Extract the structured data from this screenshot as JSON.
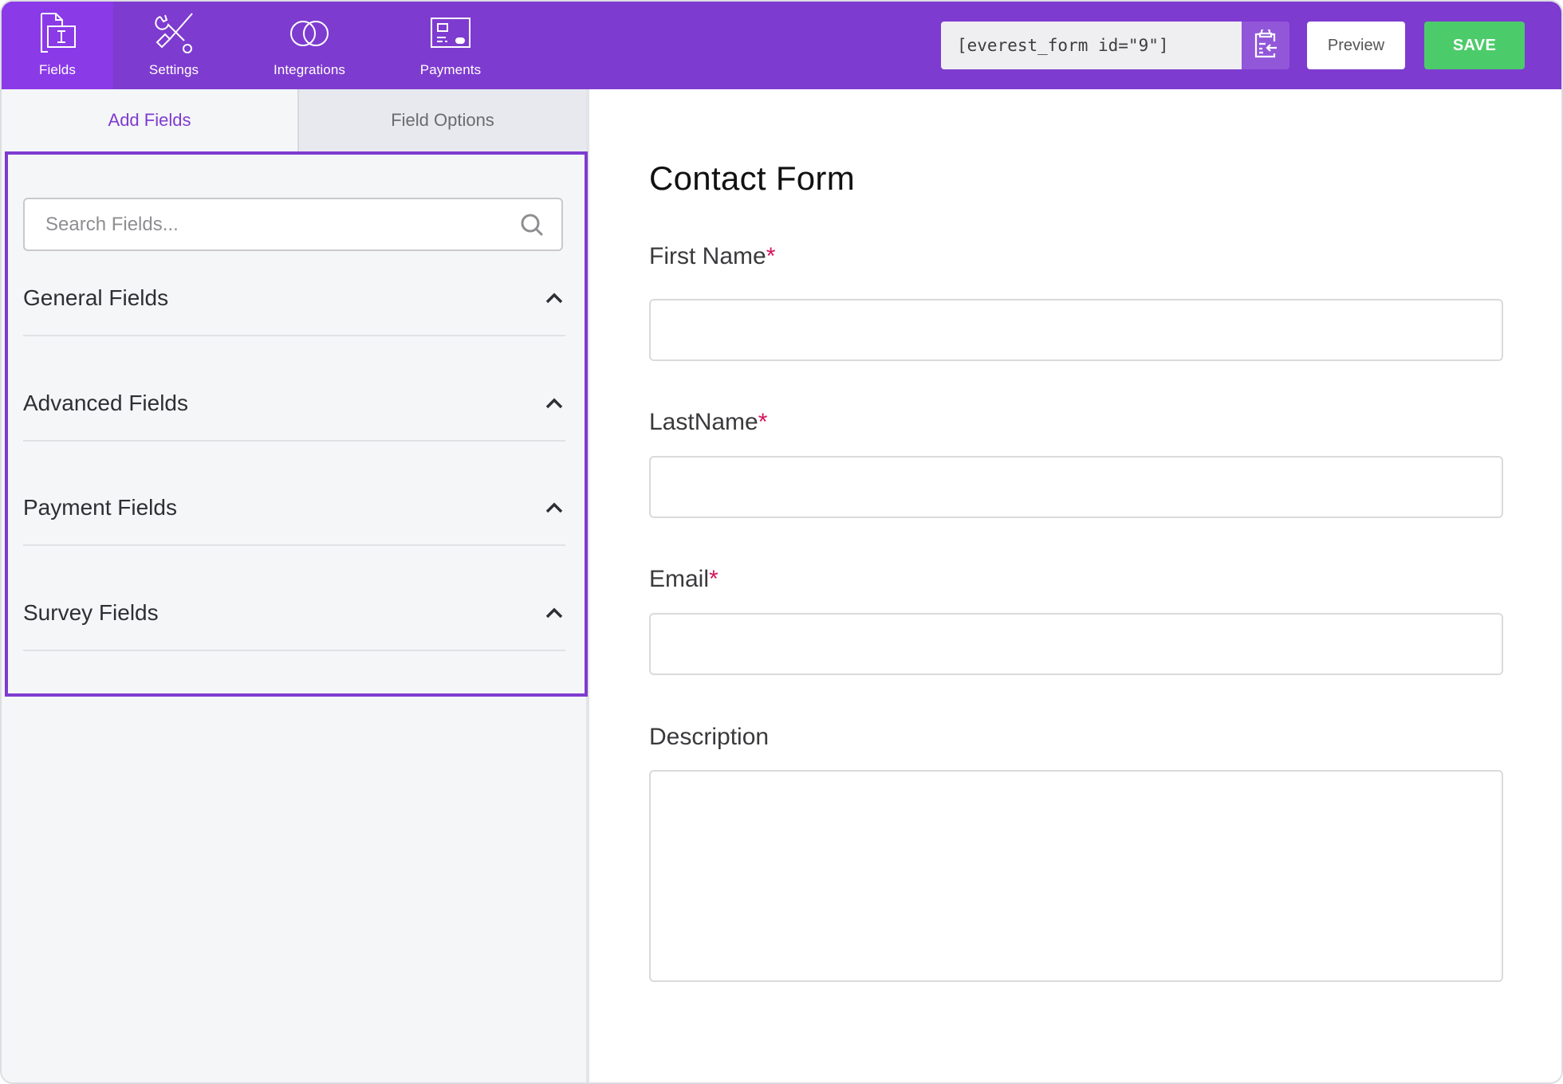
{
  "header": {
    "nav": [
      {
        "id": "fields",
        "label": "Fields",
        "icon": "fields-icon",
        "active": true
      },
      {
        "id": "settings",
        "label": "Settings",
        "icon": "settings-tools-icon",
        "active": false
      },
      {
        "id": "integrations",
        "label": "Integrations",
        "icon": "integrations-rings-icon",
        "active": false
      },
      {
        "id": "payments",
        "label": "Payments",
        "icon": "payments-card-icon",
        "active": false
      }
    ],
    "shortcode": "[everest_form id=\"9\"]",
    "copy_icon": "clipboard-copy-icon",
    "preview_label": "Preview",
    "save_label": "SAVE"
  },
  "left_panel": {
    "tabs": [
      {
        "label": "Add Fields",
        "active": true
      },
      {
        "label": "Field Options",
        "active": false
      }
    ],
    "search": {
      "placeholder": "Search Fields...",
      "value": "",
      "icon": "search-icon"
    },
    "sections": [
      {
        "label": "General Fields",
        "expanded": true
      },
      {
        "label": "Advanced Fields",
        "expanded": true
      },
      {
        "label": "Payment Fields",
        "expanded": true
      },
      {
        "label": "Survey Fields",
        "expanded": true
      }
    ]
  },
  "form": {
    "title": "Contact Form",
    "fields": [
      {
        "label": "First Name",
        "required": true,
        "type": "text",
        "value": ""
      },
      {
        "label": "LastName",
        "required": true,
        "type": "text",
        "value": ""
      },
      {
        "label": "Email",
        "required": true,
        "type": "email",
        "value": ""
      },
      {
        "label": "Description",
        "required": false,
        "type": "textarea",
        "value": ""
      }
    ],
    "required_marker": "*"
  },
  "colors": {
    "brand": "#7e3bd0",
    "active_tab": "#8b3ae8",
    "save": "#4ccb6a",
    "required": "#d6145c"
  }
}
